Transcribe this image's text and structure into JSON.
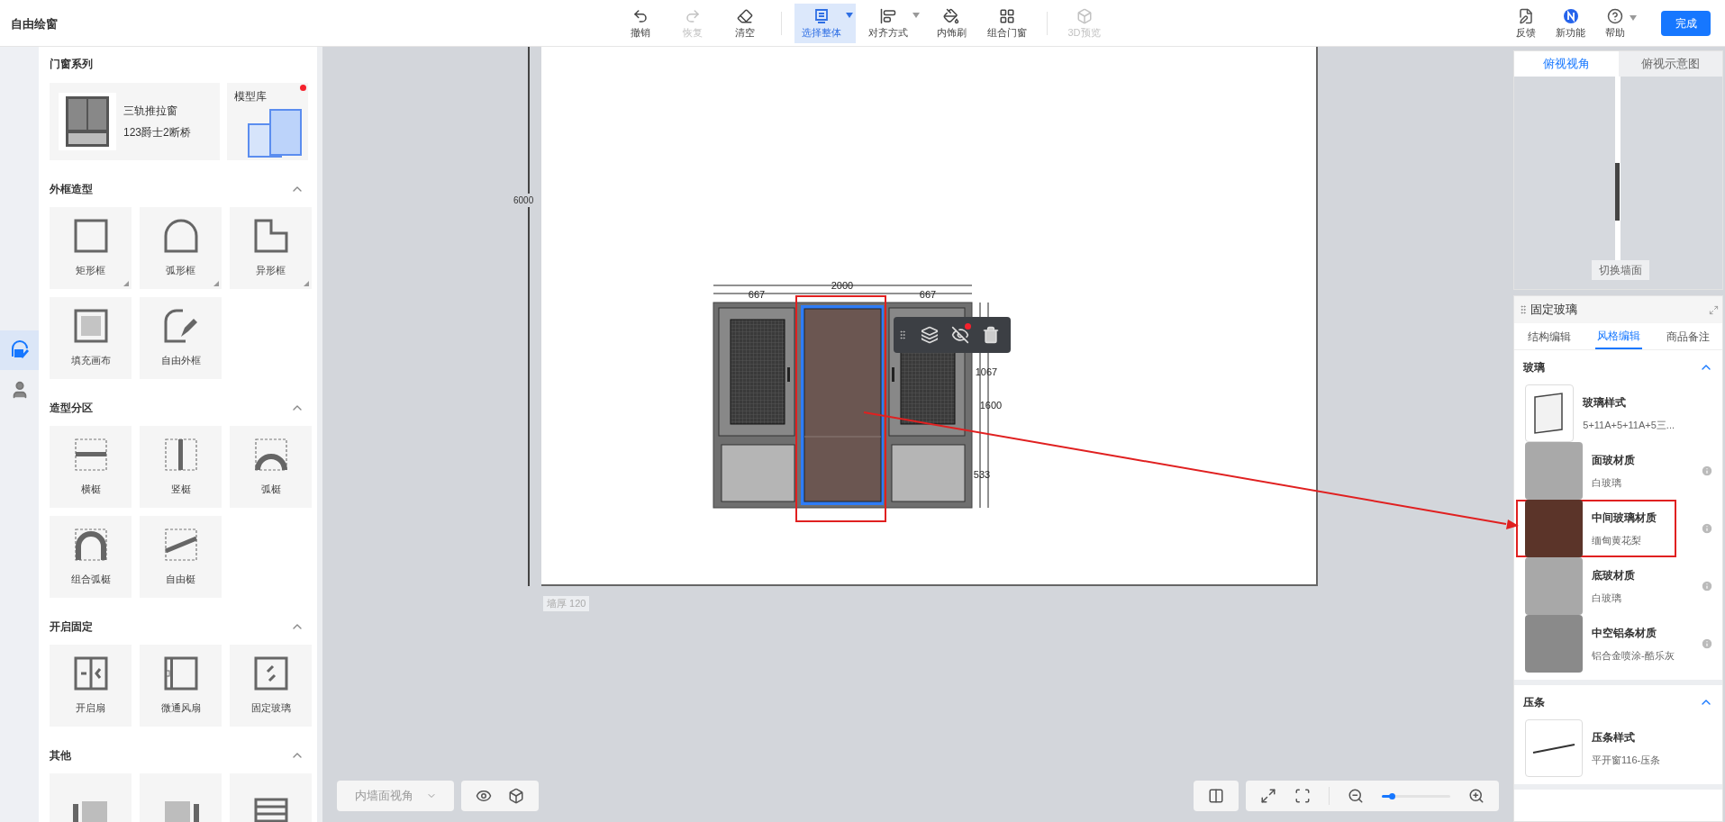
{
  "app_title": "自由绘窗",
  "toolbar": [
    {
      "label": "撤销",
      "disabled": false,
      "selected": false,
      "dropdown": false
    },
    {
      "label": "恢复",
      "disabled": true,
      "selected": false,
      "dropdown": false
    },
    {
      "label": "清空",
      "disabled": false,
      "selected": false,
      "dropdown": false
    },
    {
      "label": "选择整体",
      "disabled": false,
      "selected": true,
      "dropdown": true
    },
    {
      "label": "对齐方式",
      "disabled": false,
      "selected": false,
      "dropdown": true
    },
    {
      "label": "内饰刷",
      "disabled": false,
      "selected": false,
      "dropdown": false
    },
    {
      "label": "组合门窗",
      "disabled": false,
      "selected": false,
      "dropdown": false
    },
    {
      "label": "3D预览",
      "disabled": true,
      "selected": false,
      "dropdown": false
    }
  ],
  "top_right": [
    {
      "label": "反馈",
      "dropdown": false
    },
    {
      "label": "新功能",
      "dropdown": false
    },
    {
      "label": "帮助",
      "dropdown": true
    }
  ],
  "done_button": "完成",
  "left_rail": [
    {
      "selected": true
    },
    {
      "selected": false
    }
  ],
  "series": {
    "title": "门窗系列",
    "name": "三轨推拉窗",
    "spec": "123爵士2断桥",
    "library": "模型库",
    "library_badge": true
  },
  "sections": [
    {
      "title": "外框造型",
      "expanded": true,
      "items": [
        {
          "label": "矩形框",
          "corner": true
        },
        {
          "label": "弧形框",
          "corner": true
        },
        {
          "label": "异形框",
          "corner": true
        },
        {
          "label": "填充画布",
          "corner": false
        },
        {
          "label": "自由外框",
          "corner": false
        }
      ]
    },
    {
      "title": "造型分区",
      "expanded": true,
      "items": [
        {
          "label": "横梃",
          "corner": false
        },
        {
          "label": "竖梃",
          "corner": false
        },
        {
          "label": "弧梃",
          "corner": false
        },
        {
          "label": "组合弧梃",
          "corner": false
        },
        {
          "label": "自由梃",
          "corner": false
        }
      ]
    },
    {
      "title": "开启固定",
      "expanded": true,
      "items": [
        {
          "label": "开启扇",
          "corner": false
        },
        {
          "label": "微通风扇",
          "corner": false
        },
        {
          "label": "固定玻璃",
          "corner": false
        }
      ]
    },
    {
      "title": "其他",
      "expanded": true,
      "items": [
        {
          "corner": false
        },
        {
          "corner": false
        },
        {
          "corner": false
        }
      ]
    }
  ],
  "canvas": {
    "height_dim": "6000",
    "wall_thickness": "墙厚 120",
    "width_total": "2000",
    "width_parts": [
      "667",
      "667"
    ],
    "height_dims": [
      "1067",
      "1600",
      "533"
    ],
    "toolbar_badge": true
  },
  "view_tabs": [
    {
      "label": "俯视视角",
      "selected": true
    },
    {
      "label": "俯视示意图",
      "selected": false
    }
  ],
  "switch_wall": "切换墙面",
  "props": {
    "title": "固定玻璃",
    "tabs": [
      {
        "label": "结构编辑",
        "selected": false
      },
      {
        "label": "风格编辑",
        "selected": true
      },
      {
        "label": "商品备注",
        "selected": false
      }
    ],
    "groups": [
      {
        "title": "玻璃",
        "expanded": true,
        "items": [
          {
            "name": "玻璃样式",
            "value": "5+11A+5+11A+5三...",
            "kind": "glass",
            "info": false,
            "highlighted": false
          },
          {
            "name": "面玻材质",
            "value": "白玻璃",
            "kind": "swatch",
            "color": "#a9a9a9",
            "info": true,
            "highlighted": false
          },
          {
            "name": "中间玻璃材质",
            "value": "缅甸黄花梨",
            "kind": "swatch",
            "color": "#5b3429",
            "info": true,
            "highlighted": true
          },
          {
            "name": "底玻材质",
            "value": "白玻璃",
            "kind": "swatch",
            "color": "#a8a8a8",
            "info": true,
            "highlighted": false
          },
          {
            "name": "中空铝条材质",
            "value": "铝合金喷涂-酷乐灰",
            "kind": "swatch",
            "color": "#8a8a8a",
            "info": true,
            "highlighted": false
          }
        ]
      },
      {
        "title": "压条",
        "expanded": true,
        "items": [
          {
            "name": "压条样式",
            "value": "平开窗116-压条",
            "kind": "strip",
            "info": false,
            "highlighted": false
          }
        ]
      }
    ]
  },
  "bottom": {
    "view_select": "内墙面视角",
    "zoom": {
      "level": 0.15
    }
  }
}
